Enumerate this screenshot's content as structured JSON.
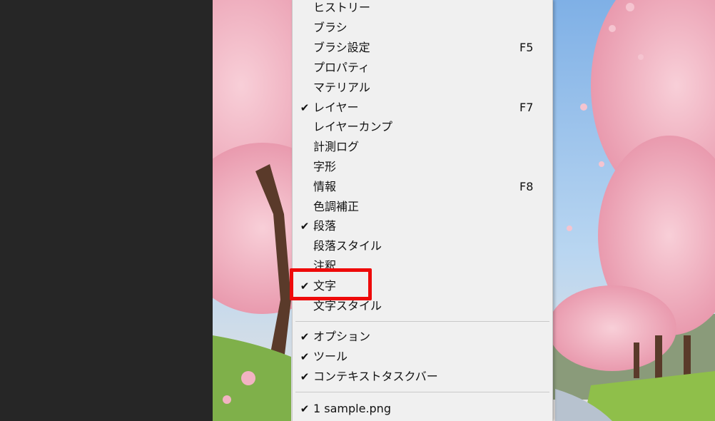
{
  "menu": {
    "items": [
      {
        "label": "ヒストリー",
        "checked": false,
        "shortcut": ""
      },
      {
        "label": "ブラシ",
        "checked": false,
        "shortcut": ""
      },
      {
        "label": "ブラシ設定",
        "checked": false,
        "shortcut": "F5"
      },
      {
        "label": "プロパティ",
        "checked": false,
        "shortcut": ""
      },
      {
        "label": "マテリアル",
        "checked": false,
        "shortcut": ""
      },
      {
        "label": "レイヤー",
        "checked": true,
        "shortcut": "F7"
      },
      {
        "label": "レイヤーカンプ",
        "checked": false,
        "shortcut": ""
      },
      {
        "label": "計測ログ",
        "checked": false,
        "shortcut": ""
      },
      {
        "label": "字形",
        "checked": false,
        "shortcut": ""
      },
      {
        "label": "情報",
        "checked": false,
        "shortcut": "F8"
      },
      {
        "label": "色調補正",
        "checked": false,
        "shortcut": ""
      },
      {
        "label": "段落",
        "checked": true,
        "shortcut": ""
      },
      {
        "label": "段落スタイル",
        "checked": false,
        "shortcut": ""
      },
      {
        "label": "注釈",
        "checked": false,
        "shortcut": ""
      },
      {
        "label": "文字",
        "checked": true,
        "shortcut": ""
      },
      {
        "label": "文字スタイル",
        "checked": false,
        "shortcut": ""
      }
    ],
    "group2": [
      {
        "label": "オプション",
        "checked": true
      },
      {
        "label": "ツール",
        "checked": true
      },
      {
        "label": "コンテキストタスクバー",
        "checked": true
      }
    ],
    "group3": [
      {
        "label": "1 sample.png",
        "checked": true
      }
    ],
    "check_glyph": "✔"
  },
  "highlight": {
    "target": "文字",
    "color": "#ee0a0a"
  },
  "colors": {
    "menu_bg": "#f0f0f0",
    "workspace_bg": "#262626",
    "sky": "#9cc4ea",
    "blossom": "#f4b9c6",
    "grass": "#8fbf4a"
  }
}
